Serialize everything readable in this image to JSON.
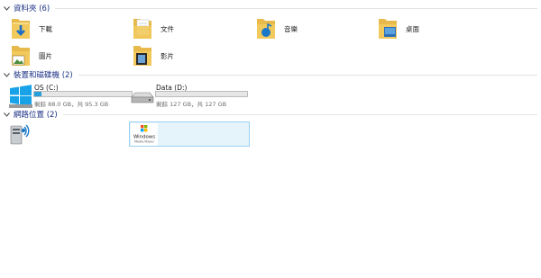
{
  "groups": {
    "folders": {
      "title": "資料夾 (6)",
      "items": [
        {
          "label": "下載",
          "icon": "downloads-folder-icon"
        },
        {
          "label": "文件",
          "icon": "documents-folder-icon"
        },
        {
          "label": "音樂",
          "icon": "music-folder-icon"
        },
        {
          "label": "桌面",
          "icon": "desktop-folder-icon"
        },
        {
          "label": "圖片",
          "icon": "pictures-folder-icon"
        },
        {
          "label": "影片",
          "icon": "videos-folder-icon"
        }
      ]
    },
    "devices": {
      "title": "裝置和磁碟機 (2)",
      "drives": [
        {
          "name": "OS (C:)",
          "info": "剩餘 88.0 GB，共 95.3 GB",
          "used_fraction": 0.077,
          "icon": "windows-drive-icon"
        },
        {
          "name": "Data (D:)",
          "info": "剩餘 127 GB，共 127 GB",
          "used_fraction": 0.0,
          "icon": "hard-drive-icon"
        }
      ]
    },
    "network": {
      "title": "網路位置 (2)",
      "items": [
        {
          "icon": "media-server-icon",
          "label": ""
        },
        {
          "icon": "windows-media-player-icon",
          "label": "",
          "selected": true
        }
      ]
    }
  },
  "colors": {
    "header_text": "#1e3287",
    "bar_fill": "#26a0da",
    "selection_bg": "#e5f3fb",
    "selection_border": "#99d1f2"
  }
}
